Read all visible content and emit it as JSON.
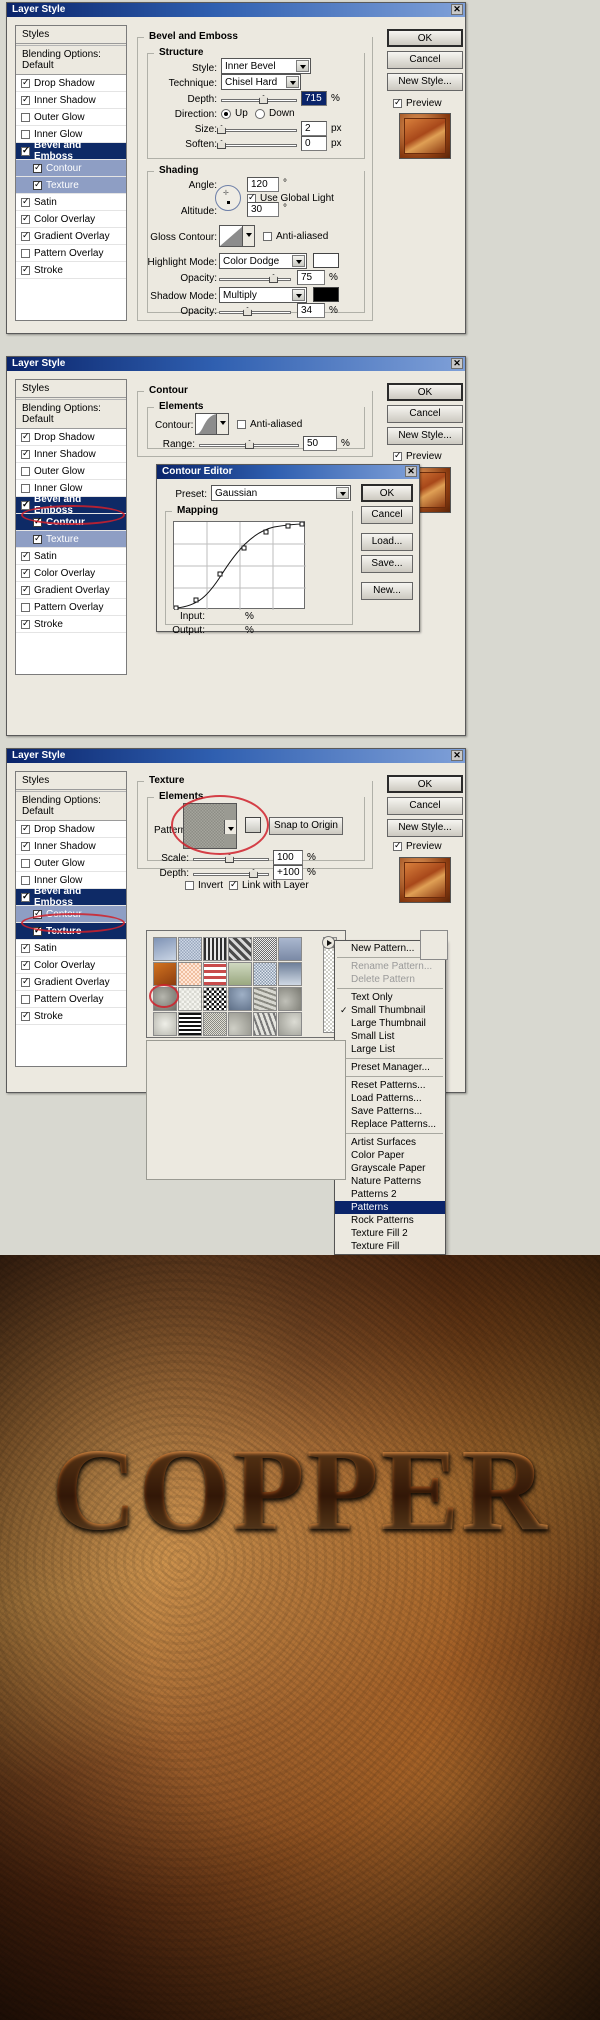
{
  "dialog1": {
    "title": "Layer Style",
    "close_label": "✕",
    "styles_header": "Styles",
    "blending_options": "Blending Options: Default",
    "style_items": [
      {
        "label": "Drop Shadow",
        "checked": true,
        "sub": false,
        "selected": false
      },
      {
        "label": "Inner Shadow",
        "checked": true,
        "sub": false,
        "selected": false
      },
      {
        "label": "Outer Glow",
        "checked": false,
        "sub": false,
        "selected": false
      },
      {
        "label": "Inner Glow",
        "checked": false,
        "sub": false,
        "selected": false
      },
      {
        "label": "Bevel and Emboss",
        "checked": true,
        "sub": false,
        "selected": true
      },
      {
        "label": "Contour",
        "checked": true,
        "sub": true,
        "selected": false
      },
      {
        "label": "Texture",
        "checked": true,
        "sub": true,
        "selected": false
      },
      {
        "label": "Satin",
        "checked": true,
        "sub": false,
        "selected": false
      },
      {
        "label": "Color Overlay",
        "checked": true,
        "sub": false,
        "selected": false
      },
      {
        "label": "Gradient Overlay",
        "checked": true,
        "sub": false,
        "selected": false
      },
      {
        "label": "Pattern Overlay",
        "checked": false,
        "sub": false,
        "selected": false
      },
      {
        "label": "Stroke",
        "checked": true,
        "sub": false,
        "selected": false
      }
    ],
    "group_title": "Bevel and Emboss",
    "structure_title": "Structure",
    "shading_title": "Shading",
    "labels": {
      "style": "Style:",
      "technique": "Technique:",
      "depth": "Depth:",
      "direction": "Direction:",
      "size": "Size:",
      "soften": "Soften:",
      "angle": "Angle:",
      "altitude": "Altitude:",
      "gloss_contour": "Gloss Contour:",
      "highlight_mode": "Highlight Mode:",
      "opacity": "Opacity:",
      "shadow_mode": "Shadow Mode:",
      "opacity2": "Opacity:"
    },
    "values": {
      "style": "Inner Bevel",
      "technique": "Chisel Hard",
      "depth": "715",
      "depth_unit": "%",
      "direction_up": "Up",
      "direction_down": "Down",
      "size": "2",
      "size_unit": "px",
      "soften": "0",
      "soften_unit": "px",
      "angle": "120",
      "degree": "°",
      "use_global_light": "Use Global Light",
      "altitude": "30",
      "anti_aliased": "Anti-aliased",
      "highlight_mode": "Color Dodge",
      "opacity": "75",
      "opacity_unit": "%",
      "shadow_mode": "Multiply",
      "opacity2": "34",
      "opacity2_unit": "%",
      "highlight_color": "#ffffff",
      "shadow_color": "#000000"
    },
    "buttons": {
      "ok": "OK",
      "cancel": "Cancel",
      "new_style": "New Style...",
      "preview": "Preview"
    }
  },
  "dialog2": {
    "title": "Layer Style",
    "close_label": "✕",
    "styles_header": "Styles",
    "blending_options": "Blending Options: Default",
    "style_items": [
      {
        "label": "Drop Shadow",
        "checked": true,
        "sub": false,
        "selected": false
      },
      {
        "label": "Inner Shadow",
        "checked": true,
        "sub": false,
        "selected": false
      },
      {
        "label": "Outer Glow",
        "checked": false,
        "sub": false,
        "selected": false
      },
      {
        "label": "Inner Glow",
        "checked": false,
        "sub": false,
        "selected": false
      },
      {
        "label": "Bevel and Emboss",
        "checked": true,
        "sub": false,
        "selected": true
      },
      {
        "label": "Contour",
        "checked": true,
        "sub": true,
        "selected": true
      },
      {
        "label": "Texture",
        "checked": true,
        "sub": true,
        "selected": false
      },
      {
        "label": "Satin",
        "checked": true,
        "sub": false,
        "selected": false
      },
      {
        "label": "Color Overlay",
        "checked": true,
        "sub": false,
        "selected": false
      },
      {
        "label": "Gradient Overlay",
        "checked": true,
        "sub": false,
        "selected": false
      },
      {
        "label": "Pattern Overlay",
        "checked": false,
        "sub": false,
        "selected": false
      },
      {
        "label": "Stroke",
        "checked": true,
        "sub": false,
        "selected": false
      }
    ],
    "group_title": "Contour",
    "elements_title": "Elements",
    "labels": {
      "contour": "Contour:",
      "range": "Range:"
    },
    "values": {
      "anti_aliased": "Anti-aliased",
      "range": "50",
      "range_unit": "%"
    },
    "buttons": {
      "ok": "OK",
      "cancel": "Cancel",
      "new_style": "New Style...",
      "preview": "Preview"
    },
    "contour_editor": {
      "title": "Contour Editor",
      "close_label": "✕",
      "preset_label": "Preset:",
      "preset_value": "Gaussian",
      "mapping_title": "Mapping",
      "input_label": "Input:",
      "input_unit": "%",
      "output_label": "Output:",
      "output_unit": "%",
      "buttons": {
        "ok": "OK",
        "cancel": "Cancel",
        "load": "Load...",
        "save": "Save...",
        "new": "New..."
      }
    }
  },
  "dialog3": {
    "title": "Layer Style",
    "close_label": "✕",
    "styles_header": "Styles",
    "blending_options": "Blending Options: Default",
    "style_items": [
      {
        "label": "Drop Shadow",
        "checked": true,
        "sub": false,
        "selected": false
      },
      {
        "label": "Inner Shadow",
        "checked": true,
        "sub": false,
        "selected": false
      },
      {
        "label": "Outer Glow",
        "checked": false,
        "sub": false,
        "selected": false
      },
      {
        "label": "Inner Glow",
        "checked": false,
        "sub": false,
        "selected": false
      },
      {
        "label": "Bevel and Emboss",
        "checked": true,
        "sub": false,
        "selected": true
      },
      {
        "label": "Contour",
        "checked": true,
        "sub": true,
        "selected": false
      },
      {
        "label": "Texture",
        "checked": true,
        "sub": true,
        "selected": true
      },
      {
        "label": "Satin",
        "checked": true,
        "sub": false,
        "selected": false
      },
      {
        "label": "Color Overlay",
        "checked": true,
        "sub": false,
        "selected": false
      },
      {
        "label": "Gradient Overlay",
        "checked": true,
        "sub": false,
        "selected": false
      },
      {
        "label": "Pattern Overlay",
        "checked": false,
        "sub": false,
        "selected": false
      },
      {
        "label": "Stroke",
        "checked": true,
        "sub": false,
        "selected": false
      }
    ],
    "group_title": "Texture",
    "elements_title": "Elements",
    "labels": {
      "pattern": "Pattern:",
      "scale": "Scale:",
      "depth": "Depth:"
    },
    "values": {
      "snap_to_origin": "Snap to Origin",
      "scale": "100",
      "scale_unit": "%",
      "depth": "+100",
      "depth_unit": "%",
      "invert": "Invert",
      "link_with_layer": "Link with Layer"
    },
    "buttons": {
      "ok": "OK",
      "cancel": "Cancel",
      "new_style": "New Style...",
      "preview": "Preview"
    },
    "context_menu": [
      {
        "label": "New Pattern...",
        "type": "item"
      },
      {
        "label": "sep",
        "type": "sep"
      },
      {
        "label": "Rename Pattern...",
        "type": "disabled"
      },
      {
        "label": "Delete Pattern",
        "type": "disabled"
      },
      {
        "label": "sep",
        "type": "sep"
      },
      {
        "label": "Text Only",
        "type": "item"
      },
      {
        "label": "Small Thumbnail",
        "type": "checked"
      },
      {
        "label": "Large Thumbnail",
        "type": "item"
      },
      {
        "label": "Small List",
        "type": "item"
      },
      {
        "label": "Large List",
        "type": "item"
      },
      {
        "label": "sep",
        "type": "sep"
      },
      {
        "label": "Preset Manager...",
        "type": "item"
      },
      {
        "label": "sep",
        "type": "sep"
      },
      {
        "label": "Reset Patterns...",
        "type": "item"
      },
      {
        "label": "Load Patterns...",
        "type": "item"
      },
      {
        "label": "Save Patterns...",
        "type": "item"
      },
      {
        "label": "Replace Patterns...",
        "type": "item"
      },
      {
        "label": "sep",
        "type": "sep"
      },
      {
        "label": "Artist Surfaces",
        "type": "item"
      },
      {
        "label": "Color Paper",
        "type": "item"
      },
      {
        "label": "Grayscale Paper",
        "type": "item"
      },
      {
        "label": "Nature Patterns",
        "type": "item"
      },
      {
        "label": "Patterns 2",
        "type": "item"
      },
      {
        "label": "Patterns",
        "type": "highlight"
      },
      {
        "label": "Rock Patterns",
        "type": "item"
      },
      {
        "label": "Texture Fill 2",
        "type": "item"
      },
      {
        "label": "Texture Fill",
        "type": "item"
      }
    ]
  },
  "banner": {
    "word": "COPPER"
  },
  "colors": {
    "titlebar_start": "#0a246a",
    "titlebar_end": "#7fa0d8",
    "dialog_bg": "#ece9e0",
    "selection": "#0e2a66",
    "sub_selection": "#8e9ec4",
    "annotation": "#d0202a"
  }
}
